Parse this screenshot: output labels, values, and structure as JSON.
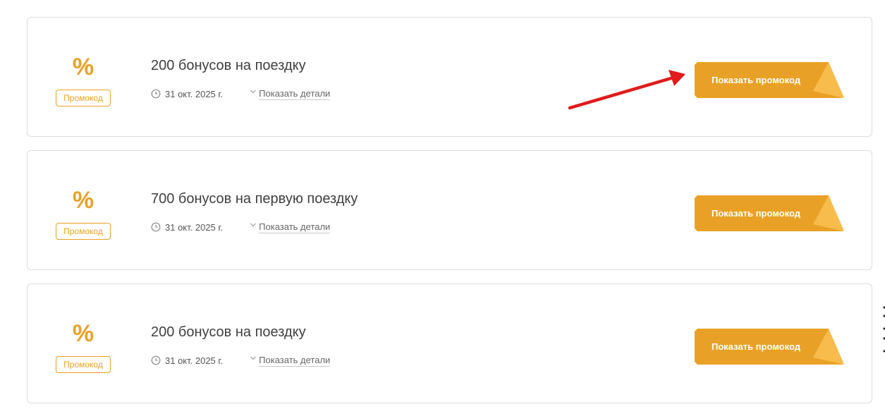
{
  "offers": [
    {
      "icon": "percent-icon",
      "percent_symbol": "%",
      "label": "Промокод",
      "title": "200 бонусов на поездку",
      "date": "31 окт. 2025 г.",
      "details_label": "Показать детали",
      "button_label": "Показать промокод"
    },
    {
      "icon": "percent-icon",
      "percent_symbol": "%",
      "label": "Промокод",
      "title": "700 бонусов на первую поездку",
      "date": "31 окт. 2025 г.",
      "details_label": "Показать детали",
      "button_label": "Показать промокод"
    },
    {
      "icon": "percent-icon",
      "percent_symbol": "%",
      "label": "Промокод",
      "title": "200 бонусов на поездку",
      "date": "31 окт. 2025 г.",
      "details_label": "Показать детали",
      "button_label": "Показать промокод"
    }
  ],
  "colors": {
    "accent": "#e8a126",
    "accent_light": "#f7bc4b",
    "annotation_arrow": "#e01b1b",
    "card_border": "#dcdcdc"
  }
}
